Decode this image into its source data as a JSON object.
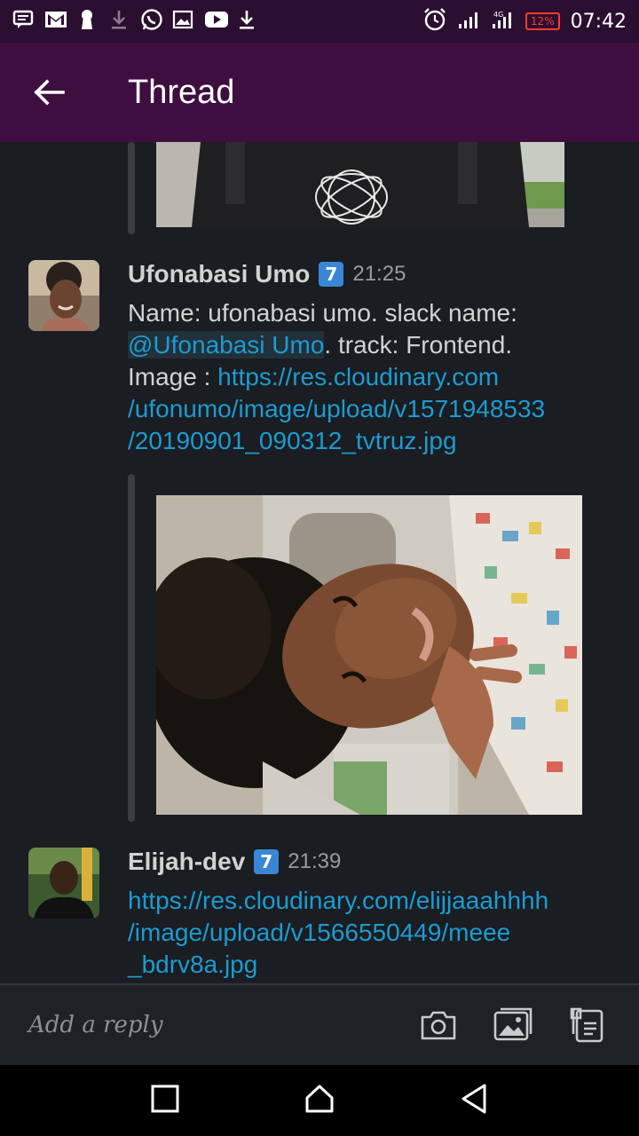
{
  "status_bar": {
    "battery": "12%",
    "time": "07:42"
  },
  "header": {
    "title": "Thread"
  },
  "messages": [
    {
      "author": "Ufonabasi Umo",
      "badge": "7",
      "time": "21:25",
      "text_name": "Name: ufonabasi umo. slack name: ",
      "mention": "@Ufonabasi Umo",
      "text_track": ". track: Frontend.",
      "text_image": "Image : ",
      "link_line1": "https://res.cloudinary.com",
      "link_line2": "/ufonumo/image/upload/v1571948533",
      "link_line3": "/20190901_090312_tvtruz.jpg"
    },
    {
      "author": "Elijah-dev",
      "badge": "7",
      "time": "21:39",
      "link_line1": "https://res.cloudinary.com/elijjaaahhhh",
      "link_line2": "/image/upload/v1566550449/meee",
      "link_line3": "_bdrv8a.jpg"
    }
  ],
  "reply_bar": {
    "placeholder": "Add a reply"
  },
  "colors": {
    "status_bar": "#2b0f30",
    "header": "#3f0e40",
    "background": "#1a1d21",
    "link": "#1d9bd1"
  }
}
